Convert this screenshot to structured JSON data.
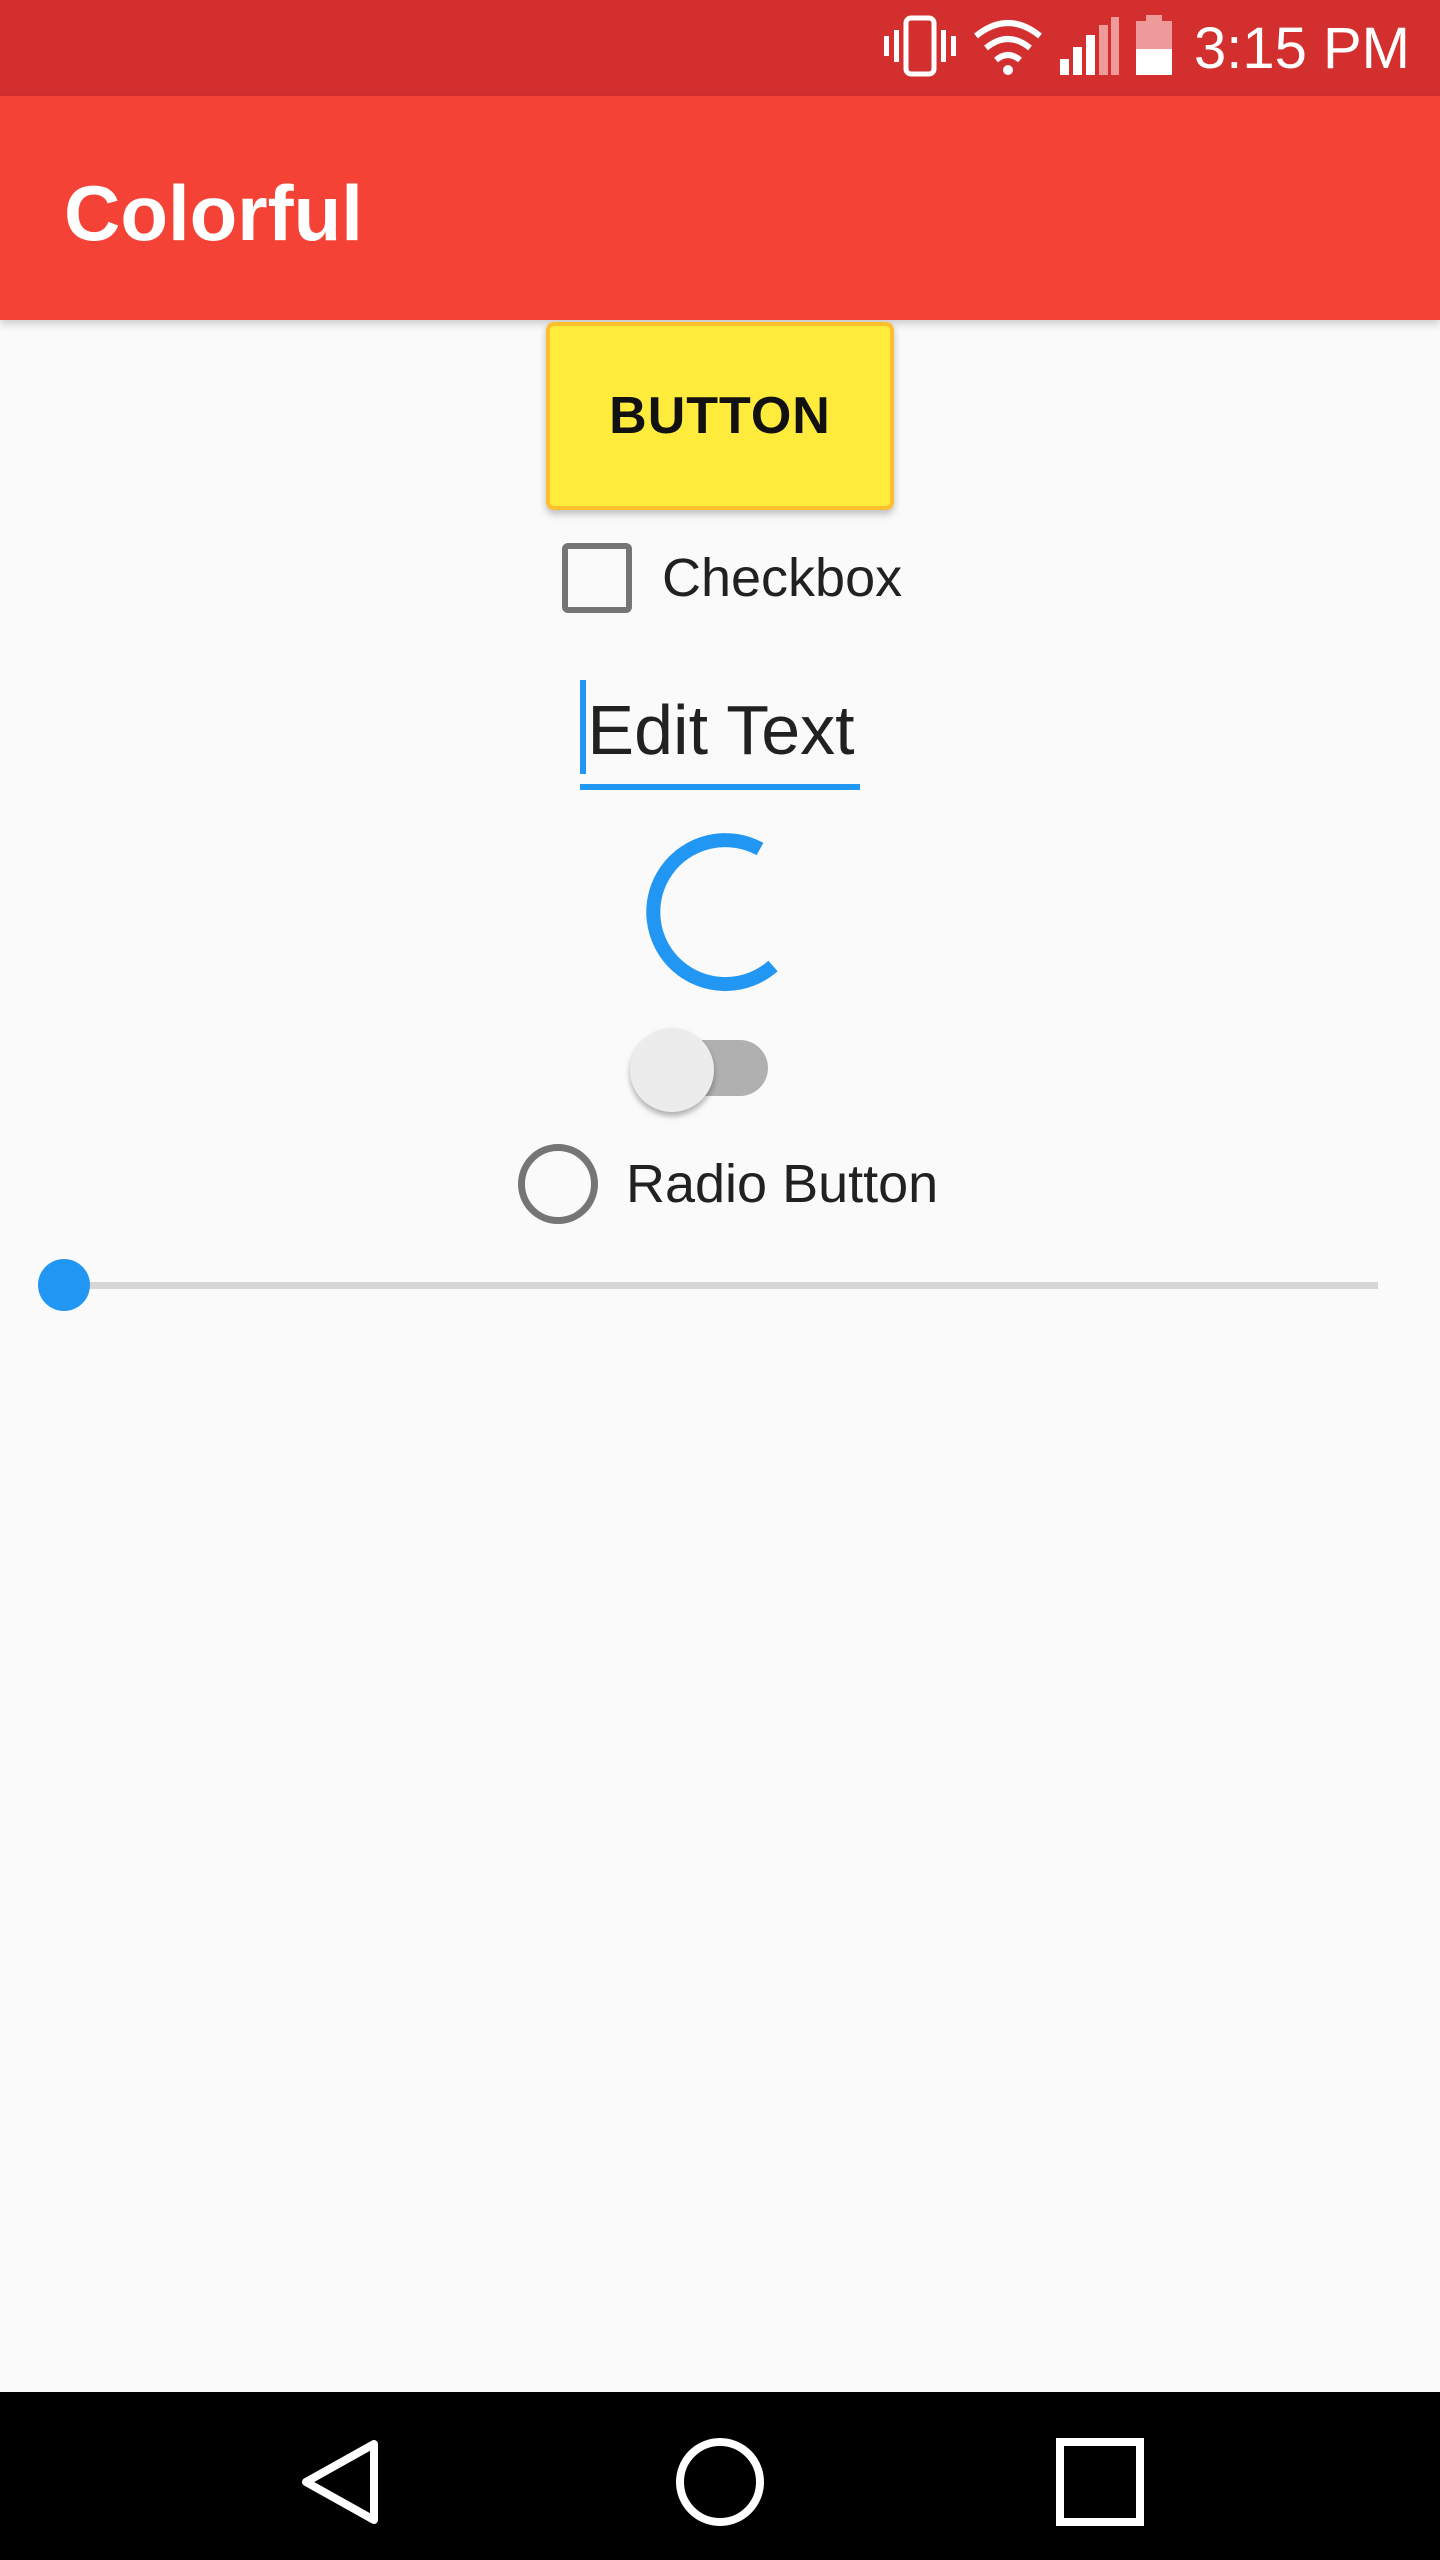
{
  "status_bar": {
    "time": "3:15 PM",
    "icons": [
      "vibrate-icon",
      "wifi-icon",
      "signal-icon",
      "battery-icon"
    ],
    "background_color": "#D32F2F"
  },
  "app_bar": {
    "title": "Colorful",
    "background_color": "#F44336"
  },
  "widgets": {
    "button_label": "BUTTON",
    "button_color": "#FFEB3B",
    "checkbox_label": "Checkbox",
    "checkbox_checked": false,
    "edit_text_value": "Edit Text",
    "accent_color": "#2196F3",
    "switch_on": false,
    "radio_label": "Radio Button",
    "radio_selected": false,
    "seekbar_progress": 0
  },
  "navigation_bar": {
    "buttons": [
      "back-icon",
      "home-icon",
      "recents-icon"
    ]
  }
}
